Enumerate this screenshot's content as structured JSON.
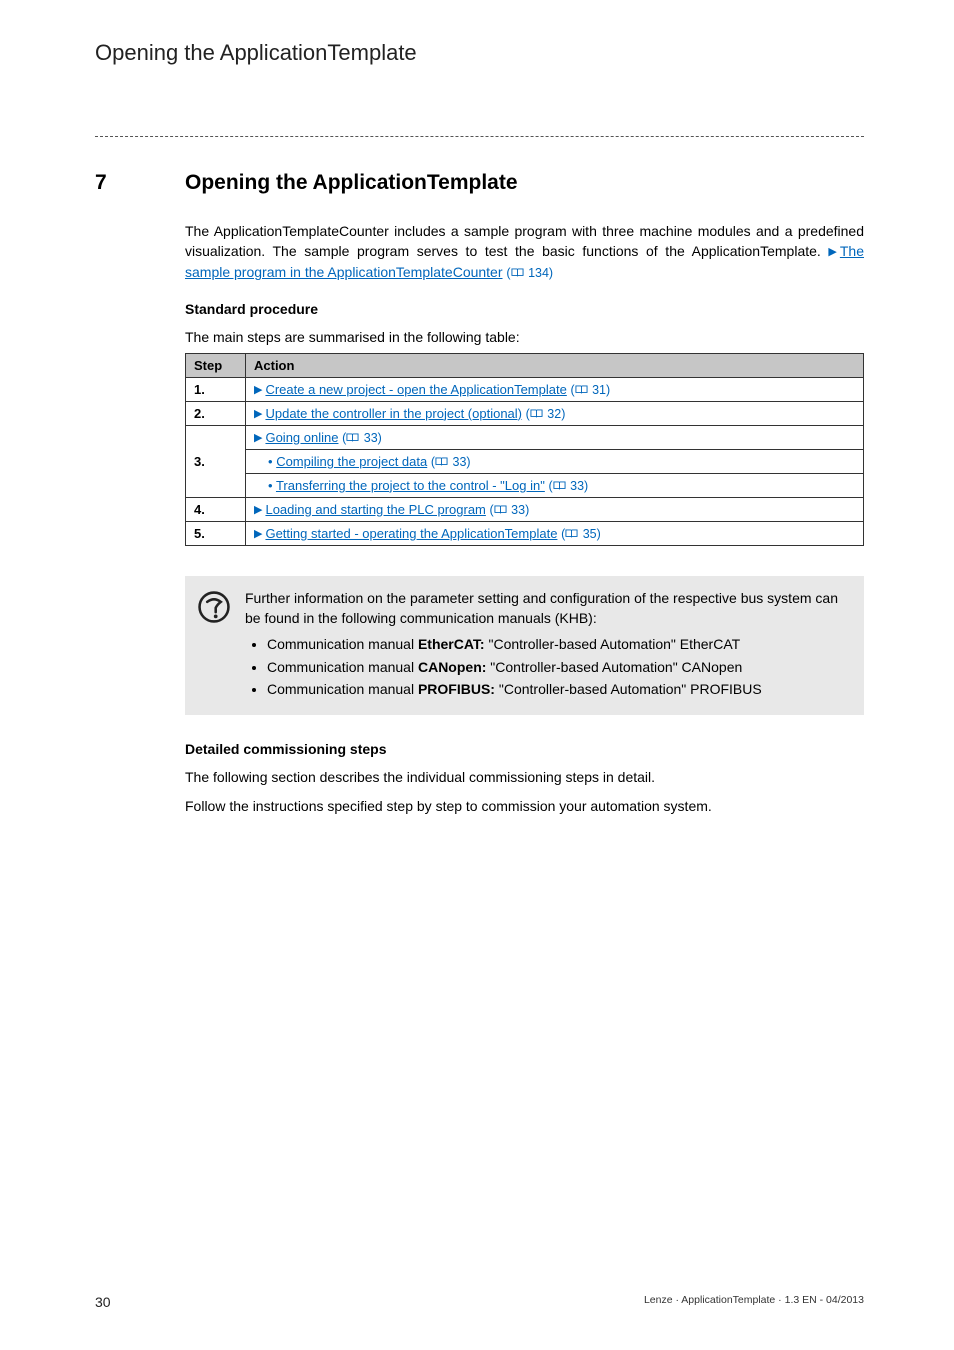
{
  "running_head": "Opening the ApplicationTemplate",
  "section": {
    "num": "7",
    "title": "Opening the ApplicationTemplate"
  },
  "intro": {
    "text_prefix": "The ApplicationTemplateCounter includes a sample program with three machine modules and a predefined visualization. The sample program serves to test the basic functions of the ApplicationTemplate.",
    "link_text": "The sample program in the ApplicationTemplateCounter",
    "pageref": "134"
  },
  "standard_procedure": {
    "heading": "Standard procedure",
    "lead": "The main steps are summarised in the following table:",
    "columns": {
      "step": "Step",
      "action": "Action"
    },
    "rows": [
      {
        "step": "1.",
        "text": "Create a new project - open the ApplicationTemplate",
        "page": "31",
        "arrow": true
      },
      {
        "step": "2.",
        "text": "Update the controller in the project (optional)",
        "page": "32",
        "arrow": true
      },
      {
        "step": "3.",
        "text": "Going online",
        "page": "33",
        "arrow": true
      },
      {
        "step": "",
        "text": "Compiling the project data",
        "page": "33",
        "bullet": true,
        "sub": true
      },
      {
        "step": "",
        "text": "Transferring the project to the control - \"Log in\"",
        "page": "33",
        "bullet": true,
        "sub": true
      },
      {
        "step": "4.",
        "text": "Loading and starting the PLC program",
        "page": "33",
        "arrow": true
      },
      {
        "step": "5.",
        "text": "Getting started - operating the ApplicationTemplate",
        "page": "35",
        "arrow": true
      }
    ]
  },
  "note": {
    "intro": "Further information on the parameter setting and configuration of the respective bus system can be found in the following communication manuals (KHB):",
    "items": [
      {
        "prefix": "Communication manual ",
        "bold": "EtherCAT:",
        "suffix": " \"Controller-based Automation\" EtherCAT"
      },
      {
        "prefix": "Communication manual ",
        "bold": "CANopen:",
        "suffix": " \"Controller-based Automation\" CANopen"
      },
      {
        "prefix": "Communication manual ",
        "bold": "PROFIBUS:",
        "suffix": " \"Controller-based Automation\" PROFIBUS"
      }
    ]
  },
  "detailed": {
    "heading": "Detailed commissioning steps",
    "p1": "The following section describes the individual commissioning steps in detail.",
    "p2": "Follow the instructions specified step by step to commission your automation system."
  },
  "footer": {
    "page": "30",
    "meta": "Lenze · ApplicationTemplate · 1.3 EN - 04/2013"
  }
}
